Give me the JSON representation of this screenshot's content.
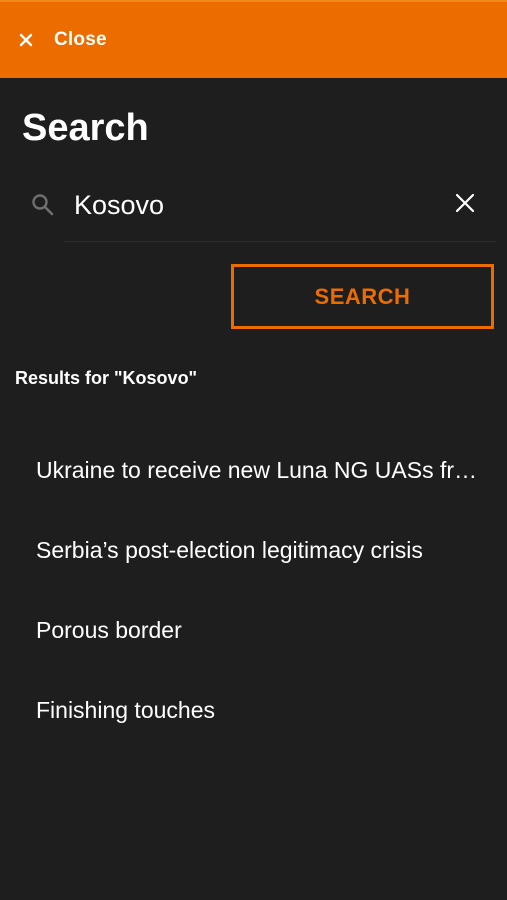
{
  "topbar": {
    "close_label": "Close",
    "close_icon": "close-icon",
    "background_color": "#ec6c00"
  },
  "page": {
    "title": "Search"
  },
  "search": {
    "value": "Kosovo",
    "icon": "search-icon",
    "clear_icon": "clear-icon",
    "button_label": "SEARCH",
    "accent_color": "#ec6c00"
  },
  "results": {
    "heading": "Results for \"Kosovo\"",
    "items": [
      {
        "title": "Ukraine to receive new Luna NG UASs from Germany"
      },
      {
        "title": "Serbia’s post-election legitimacy crisis"
      },
      {
        "title": "Porous border"
      },
      {
        "title": "Finishing touches"
      }
    ]
  }
}
